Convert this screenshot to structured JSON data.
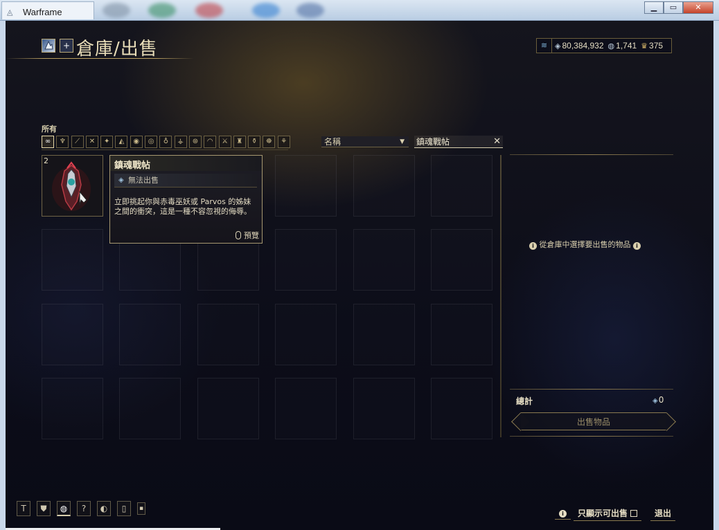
{
  "window": {
    "title": "Warframe",
    "minimize": "▁",
    "maximize": "▭",
    "close": "✕"
  },
  "header": {
    "title": "倉庫/出售",
    "icons": [
      "profile-icon",
      "add-icon"
    ],
    "add_glyph": "+"
  },
  "currency": {
    "credits": "80,384,932",
    "platinum": "1,741",
    "ducats": "375"
  },
  "filters": {
    "category_label": "所有",
    "categories": [
      {
        "name": "all",
        "glyph": "∞"
      },
      {
        "name": "warframes",
        "glyph": "♆"
      },
      {
        "name": "primary",
        "glyph": "⟋"
      },
      {
        "name": "secondary",
        "glyph": "✕"
      },
      {
        "name": "melee",
        "glyph": "✦"
      },
      {
        "name": "archwing",
        "glyph": "◭"
      },
      {
        "name": "sentinels",
        "glyph": "◉"
      },
      {
        "name": "mods",
        "glyph": "◎"
      },
      {
        "name": "resources",
        "glyph": "♁"
      },
      {
        "name": "relics",
        "glyph": "⚶"
      },
      {
        "name": "fish",
        "glyph": "⊛"
      },
      {
        "name": "arcanes",
        "glyph": "◠"
      },
      {
        "name": "misc",
        "glyph": "⚔"
      },
      {
        "name": "gear",
        "glyph": "♜"
      },
      {
        "name": "captura",
        "glyph": "⚱"
      },
      {
        "name": "emotes",
        "glyph": "☸"
      },
      {
        "name": "decorations",
        "glyph": "⚘"
      }
    ],
    "sort_label": "名稱",
    "search_value": "鎮魂戰帖"
  },
  "inventory": {
    "item": {
      "quantity": "2",
      "name": "鎮魂戰帖"
    }
  },
  "tooltip": {
    "name": "鎮魂戰帖",
    "status": "無法出售",
    "description": "立即挑起你與赤毒巫妖或 Parvos 的姊妹之間的衝突，這是一種不容忽視的侮辱。",
    "preview": "預覽"
  },
  "sell_panel": {
    "hint": "從倉庫中選擇要出售的物品",
    "total_label": "總計",
    "total_value": "0",
    "sell_button": "出售物品"
  },
  "footer": {
    "icons": [
      "text-icon",
      "shield-icon",
      "avatar-icon",
      "help-icon",
      "mouse-icon",
      "phone-icon",
      "small-icon"
    ],
    "info_glyph": "i",
    "sellable_only_label": "只顯示可出售",
    "exit_label": "退出"
  }
}
